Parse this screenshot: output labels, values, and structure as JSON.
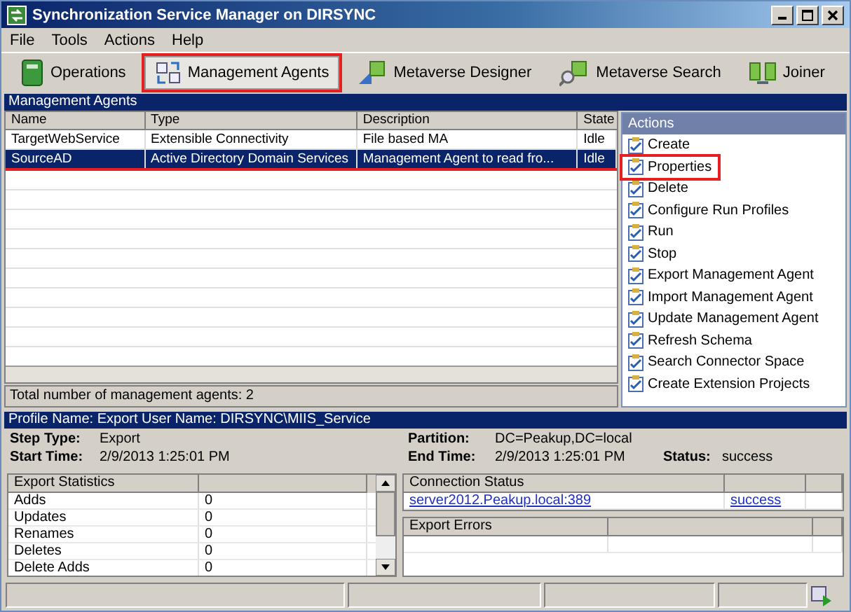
{
  "window": {
    "title": "Synchronization Service Manager on DIRSYNC"
  },
  "menu": [
    "File",
    "Tools",
    "Actions",
    "Help"
  ],
  "toolbar": [
    {
      "label": "Operations",
      "kind": "book",
      "selected": false,
      "highlighted": false
    },
    {
      "label": "Management Agents",
      "kind": "arrows",
      "selected": true,
      "highlighted": true
    },
    {
      "label": "Metaverse Designer",
      "kind": "designer",
      "selected": false,
      "highlighted": false
    },
    {
      "label": "Metaverse Search",
      "kind": "search",
      "selected": false,
      "highlighted": false
    },
    {
      "label": "Joiner",
      "kind": "joiner",
      "selected": false,
      "highlighted": false
    }
  ],
  "agents_panel": {
    "title": "Management Agents",
    "columns": [
      "Name",
      "Type",
      "Description",
      "State"
    ],
    "rows": [
      {
        "cells": [
          "TargetWebService",
          "Extensible Connectivity",
          "File based MA",
          "Idle"
        ],
        "selected": false,
        "highlighted": false
      },
      {
        "cells": [
          "SourceAD",
          "Active Directory Domain Services",
          "Management Agent to read fro...",
          "Idle"
        ],
        "selected": true,
        "highlighted": true
      }
    ],
    "total": "Total number of management agents: 2"
  },
  "actions": {
    "title": "Actions",
    "items": [
      {
        "label": "Create",
        "highlighted": false
      },
      {
        "label": "Properties",
        "highlighted": true
      },
      {
        "label": "Delete",
        "highlighted": false
      },
      {
        "label": "Configure Run Profiles",
        "highlighted": false
      },
      {
        "label": "Run",
        "highlighted": false
      },
      {
        "label": "Stop",
        "highlighted": false
      },
      {
        "label": "Export Management Agent",
        "highlighted": false
      },
      {
        "label": "Import Management Agent",
        "highlighted": false
      },
      {
        "label": "Update Management Agent",
        "highlighted": false
      },
      {
        "label": "Refresh Schema",
        "highlighted": false
      },
      {
        "label": "Search Connector Space",
        "highlighted": false
      },
      {
        "label": "Create Extension Projects",
        "highlighted": false
      }
    ]
  },
  "profile": {
    "header": "Profile Name: Export  User Name: DIRSYNC\\MIIS_Service",
    "rows": [
      [
        {
          "label": "Step Type:",
          "value": "Export"
        },
        {
          "label": "Partition:",
          "value": "DC=Peakup,DC=local"
        }
      ],
      [
        {
          "label": "Start Time:",
          "value": "2/9/2013 1:25:01 PM"
        },
        {
          "label": "End Time:",
          "value": "2/9/2013 1:25:01 PM"
        },
        {
          "label": "Status:",
          "value": "success"
        }
      ]
    ]
  },
  "export_statistics": {
    "title": "Export Statistics",
    "rows": [
      [
        "Adds",
        "0"
      ],
      [
        "Updates",
        "0"
      ],
      [
        "Renames",
        "0"
      ],
      [
        "Deletes",
        "0"
      ],
      [
        "Delete Adds",
        "0"
      ]
    ]
  },
  "connection_status": {
    "title": "Connection Status",
    "rows": [
      [
        "server2012.Peakup.local:389",
        "success"
      ]
    ]
  },
  "export_errors": {
    "title": "Export Errors"
  }
}
